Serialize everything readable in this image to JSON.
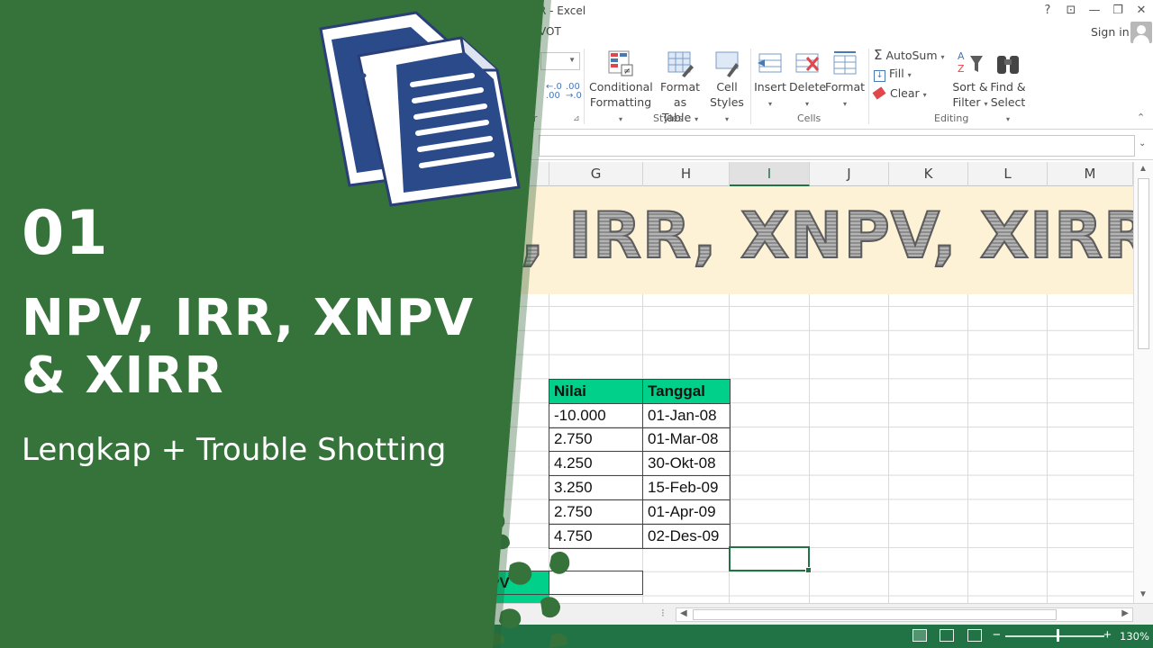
{
  "window": {
    "title_fragment": "R - Excel",
    "help": "?",
    "ribbon_display": "⊡",
    "minimize": "—",
    "restore": "❐",
    "close": "✕"
  },
  "tabs": {
    "visible_fragment": "VOT"
  },
  "account": {
    "signin": "Sign in"
  },
  "ribbon": {
    "number_group_tail": "r",
    "styles": {
      "conditional_formatting": [
        "Conditional",
        "Formatting"
      ],
      "format_as_table": [
        "Format as",
        "Table"
      ],
      "cell_styles": [
        "Cell",
        "Styles"
      ],
      "label": "Styles"
    },
    "cells": {
      "insert": "Insert",
      "delete": "Delete",
      "format": "Format",
      "label": "Cells"
    },
    "editing": {
      "autosum": "AutoSum",
      "fill": "Fill",
      "clear": "Clear",
      "sort_filter": [
        "Sort &",
        "Filter"
      ],
      "find_select": [
        "Find &",
        "Select"
      ],
      "label": "Editing"
    }
  },
  "columns": [
    "G",
    "H",
    "I",
    "J",
    "K",
    "L",
    "M"
  ],
  "selected_column": "I",
  "banner_text": ", IRR, XNPV, XIRR",
  "table": {
    "headers": [
      "Nilai",
      "Tanggal"
    ],
    "rows": [
      [
        "-10.000",
        "01-Jan-08"
      ],
      [
        "2.750",
        "01-Mar-08"
      ],
      [
        "4.250",
        "30-Okt-08"
      ],
      [
        "3.250",
        "15-Feb-09"
      ],
      [
        "2.750",
        "01-Apr-09"
      ],
      [
        "4.750",
        "02-Des-09"
      ]
    ]
  },
  "npv_label_fragment": "PV",
  "status": {
    "zoom": "130%"
  },
  "overlay": {
    "number": "01",
    "title_line1": "NPV, IRR, XNPV",
    "title_line2": "& XIRR",
    "subtitle": "Lengkap + Trouble Shotting",
    "green": "#35733a",
    "accent_table": "#00d08a",
    "excel_green": "#217346"
  }
}
